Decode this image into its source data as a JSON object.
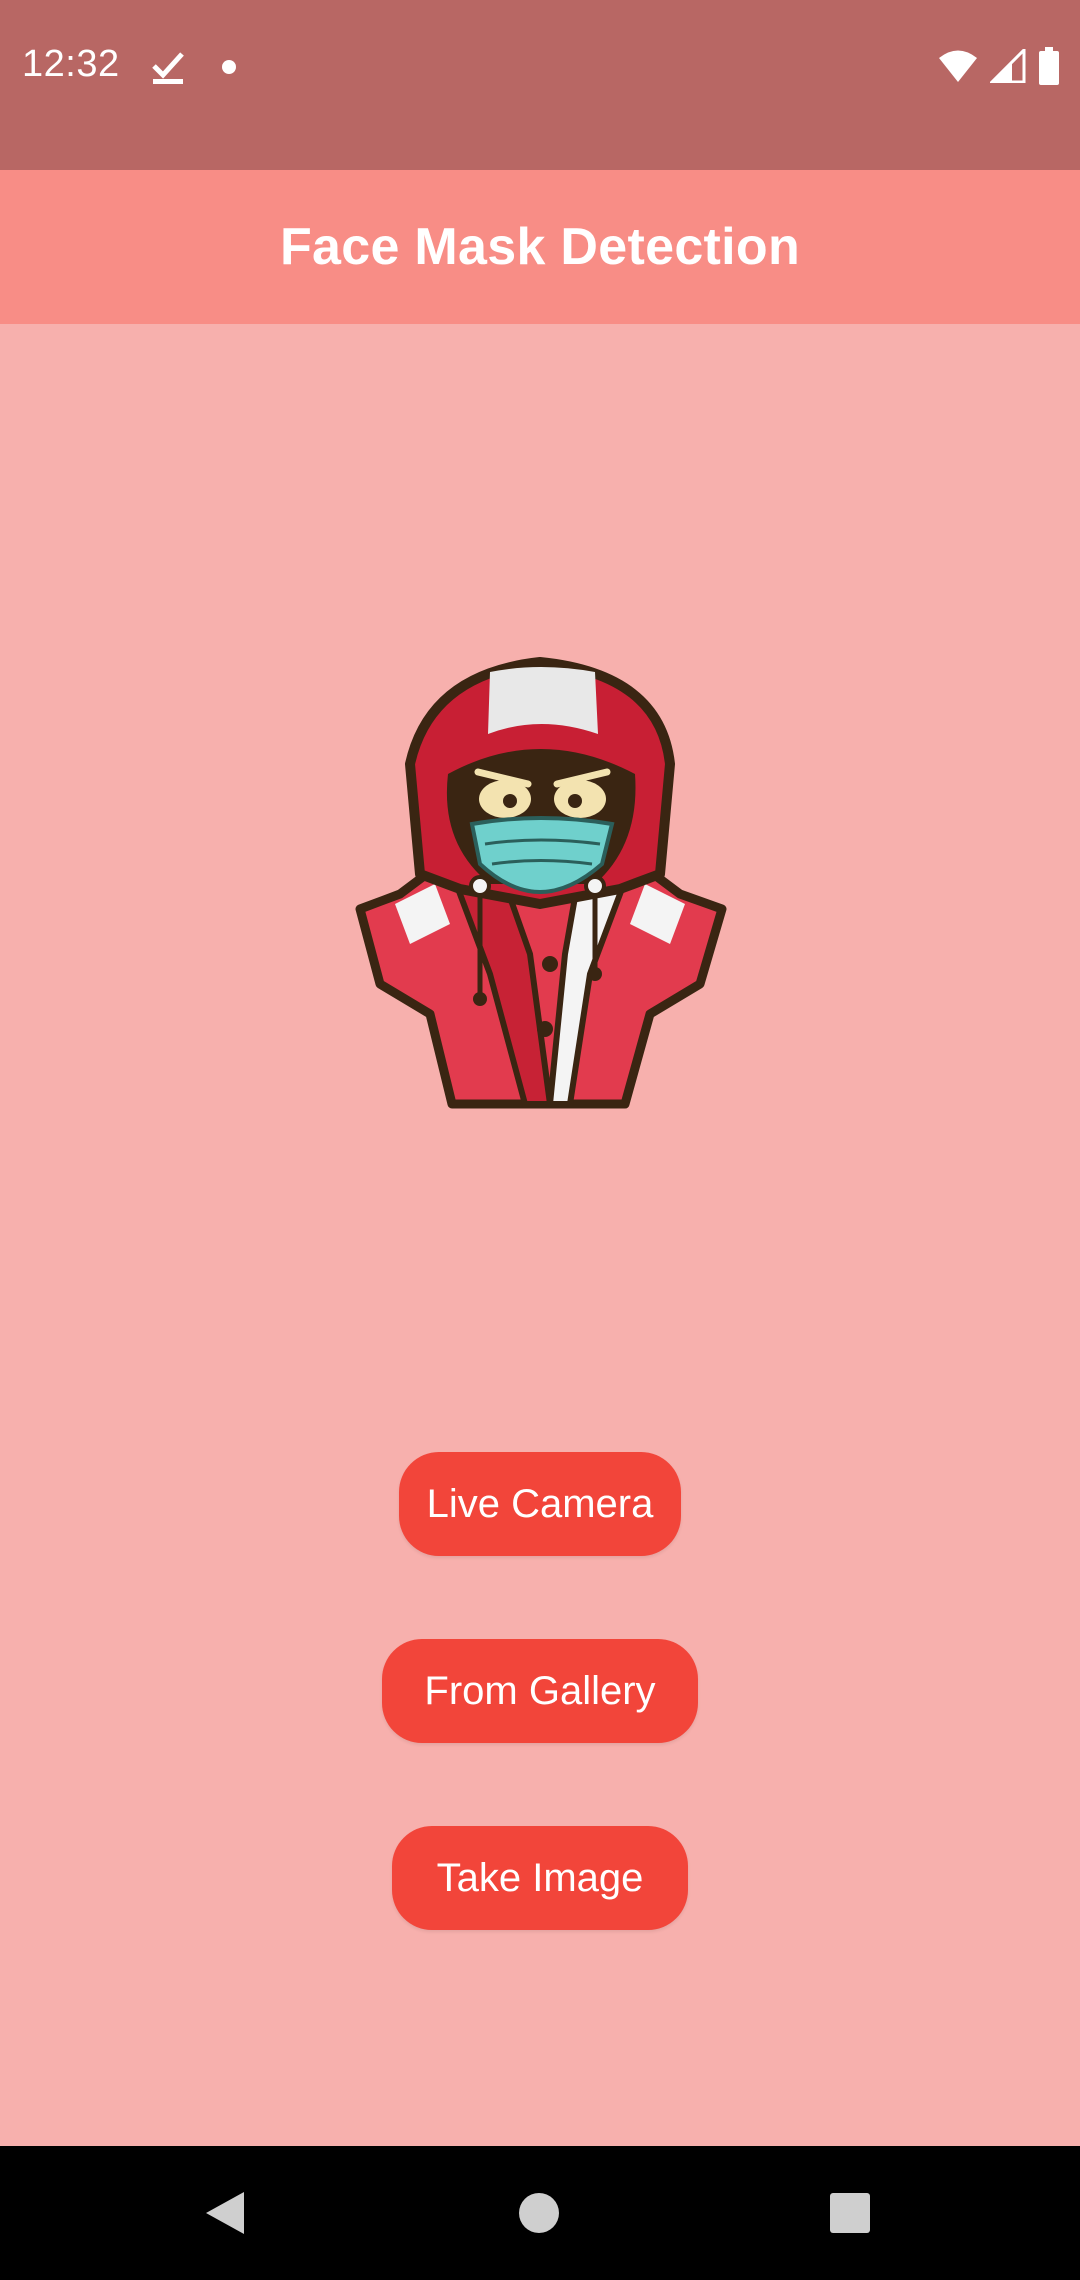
{
  "status_bar": {
    "time": "12:32",
    "icons": [
      "download-done-icon",
      "notification-dot-icon",
      "wifi-icon",
      "cellular-signal-icon",
      "battery-icon"
    ]
  },
  "app_bar": {
    "title": "Face Mask Detection"
  },
  "main": {
    "mascot": "hooded-character-with-face-mask-image",
    "buttons": [
      {
        "label": "Live Camera"
      },
      {
        "label": "From Gallery"
      },
      {
        "label": "Take Image"
      }
    ]
  },
  "nav_bar": {
    "icons": [
      "back-icon",
      "home-icon",
      "recents-icon"
    ]
  },
  "colors": {
    "status_bar": "#b86764",
    "app_bar": "#f88d86",
    "background": "#f7b0ad",
    "button": "#f2453a",
    "nav_bar": "#000000"
  }
}
